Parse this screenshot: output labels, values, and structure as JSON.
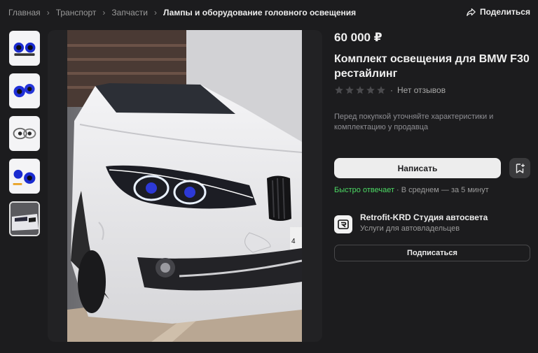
{
  "breadcrumb": {
    "items": [
      "Главная",
      "Транспорт",
      "Запчасти",
      "Лампы и оборудование головного освещения"
    ]
  },
  "share_label": "Поделиться",
  "thumbnails": [
    {
      "icon": "headlight-kit-thumbnail"
    },
    {
      "icon": "headlight-kit-thumbnail"
    },
    {
      "icon": "headlight-kit-thumbnail"
    },
    {
      "icon": "headlight-kit-thumbnail"
    },
    {
      "icon": "car-photo-thumbnail",
      "selected": true
    }
  ],
  "listing": {
    "price": "60 000 ₽",
    "title": "Комплект освещения для BMW F30 рестайлинг",
    "stars_filled": 0,
    "reviews": "Нет отзывов",
    "note": "Перед покупкой уточняйте характеристики и комплектацию у продавца"
  },
  "actions": {
    "write_label": "Написать",
    "subscribe_label": "Подписаться"
  },
  "reply": {
    "fast": "Быстро отвечает",
    "avg": "· В среднем — за 5 минут"
  },
  "seller": {
    "name": "Retrofit-KRD Студия автосвета",
    "description": "Услуги для автовладельцев",
    "logo_letter": "R"
  },
  "colors": {
    "background": "#1c1c1e",
    "accent_green": "#4cd964",
    "button_light": "#ededed"
  }
}
